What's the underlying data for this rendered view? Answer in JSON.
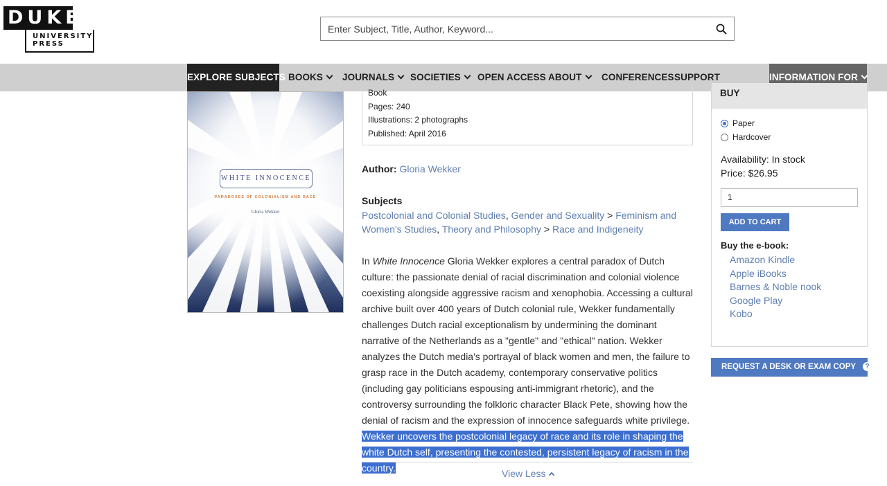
{
  "logo": {
    "line1": "DUKE",
    "line2": "UNIVERSITY",
    "line3": "PRESS"
  },
  "search": {
    "placeholder": "Enter Subject, Title, Author, Keyword...",
    "icon": "search-icon"
  },
  "nav": {
    "explore": "EXPLORE SUBJECTS",
    "books": "BOOKS",
    "journals": "JOURNALS",
    "societies": "SOCIETIES",
    "open_access": "OPEN ACCESS",
    "about": "ABOUT",
    "conferences": "CONFERENCES",
    "support": "SUPPORT",
    "info_for": "INFORMATION FOR"
  },
  "cover": {
    "title": "WHITE INNOCENCE",
    "subtitle": "PARADOXES OF COLONIALISM AND RACE",
    "author": "Gloria Wekker"
  },
  "details": {
    "format": "Book",
    "pages": "Pages: 240",
    "illustrations": "Illustrations: 2 photographs",
    "published": "Published: April 2016"
  },
  "author": {
    "label": "Author:",
    "name": "Gloria Wekker"
  },
  "subjects": {
    "heading": "Subjects",
    "s1": "Postcolonial and Colonial Studies",
    "s2": "Gender and Sexuality",
    "s3": "Feminism and Women's Studies",
    "s4": "Theory and Philosophy",
    "s5": "Race and Indigeneity",
    "sep_comma": ", ",
    "sep_arrow": " > "
  },
  "description": {
    "in": "In ",
    "title_italic": "White Innocence",
    "body": " Gloria Wekker explores a central paradox of Dutch culture: the passionate denial of racial discrimination and colonial violence coexisting alongside aggressive racism and xenophobia. Accessing a cultural archive built over 400 years of Dutch colonial rule, Wekker fundamentally challenges Dutch racial exceptionalism by undermining the dominant narrative of the Netherlands as a \"gentle\" and \"ethical\" nation. Wekker analyzes the Dutch media's portrayal of black women and men, the failure to grasp race in the Dutch academy, contemporary conservative politics (including gay politicians espousing anti-immigrant rhetoric), and the controversy surrounding the folkloric character Black Pete, showing how the denial of racism and the expression of innocence safeguards white privilege. ",
    "selected": "Wekker uncovers the postcolonial legacy of race and its role in shaping the white Dutch self, presenting the contested, persistent legacy of racism in the country."
  },
  "view_less": "View Less",
  "buy": {
    "heading": "BUY",
    "options": [
      "Paper",
      "Hardcover"
    ],
    "selected_option": "Paper",
    "availability": "Availability: In stock",
    "price": "Price: $26.95",
    "quantity": "1",
    "add_to_cart": "ADD TO CART",
    "ebook_heading": "Buy the e-book:",
    "ebook_stores": [
      "Amazon Kindle",
      "Apple iBooks",
      "Barnes & Noble nook",
      "Google Play",
      "Kobo"
    ]
  },
  "desk_copy": {
    "label": "REQUEST A DESK OR EXAM COPY",
    "icon": "question-icon",
    "glyph": "?"
  },
  "colors": {
    "nav_bg": "#cfcfcf",
    "explore_bg": "#222222",
    "info_bg": "#666666",
    "link": "#5f7fb2",
    "button": "#4f79c1",
    "selection": "#3d6fd0"
  }
}
